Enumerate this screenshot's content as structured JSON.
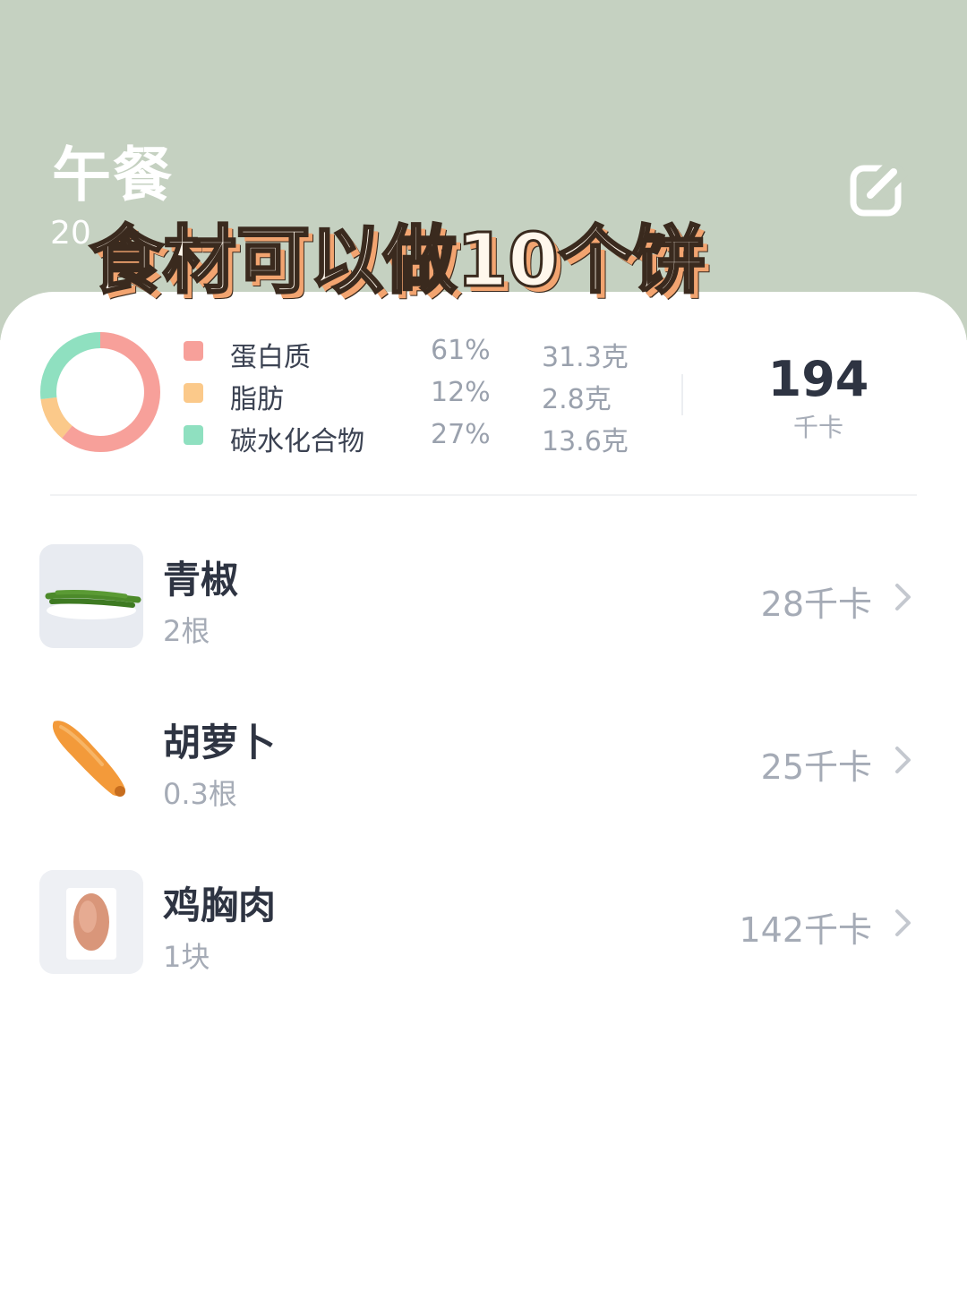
{
  "header": {
    "meal_title": "午餐",
    "date_partial": "20",
    "edit_icon": "edit-icon",
    "overlay_caption": "食材可以做10个饼"
  },
  "summary": {
    "macros": [
      {
        "name": "蛋白质",
        "percent": "61%",
        "amount": "31.3克",
        "color": "#f7a09a"
      },
      {
        "name": "脂肪",
        "percent": "12%",
        "amount": "2.8克",
        "color": "#fbc98a"
      },
      {
        "name": "碳水化合物",
        "percent": "27%",
        "amount": "13.6克",
        "color": "#8fe0c0"
      }
    ],
    "donut": {
      "protein": 0.61,
      "fat": 0.12,
      "carbs": 0.27
    },
    "total_kcal": "194",
    "kcal_unit": "千卡"
  },
  "foods": [
    {
      "name": "青椒",
      "quantity": "2根",
      "kcal": "28千卡",
      "image": "green-pepper-image"
    },
    {
      "name": "胡萝卜",
      "quantity": "0.3根",
      "kcal": "25千卡",
      "image": "carrot-image"
    },
    {
      "name": "鸡胸肉",
      "quantity": "1块",
      "kcal": "142千卡",
      "image": "chicken-breast-image"
    }
  ],
  "colors": {
    "header_bg": "#c5d1c1",
    "text_primary": "#2e3442",
    "text_secondary": "#a5abb6"
  }
}
